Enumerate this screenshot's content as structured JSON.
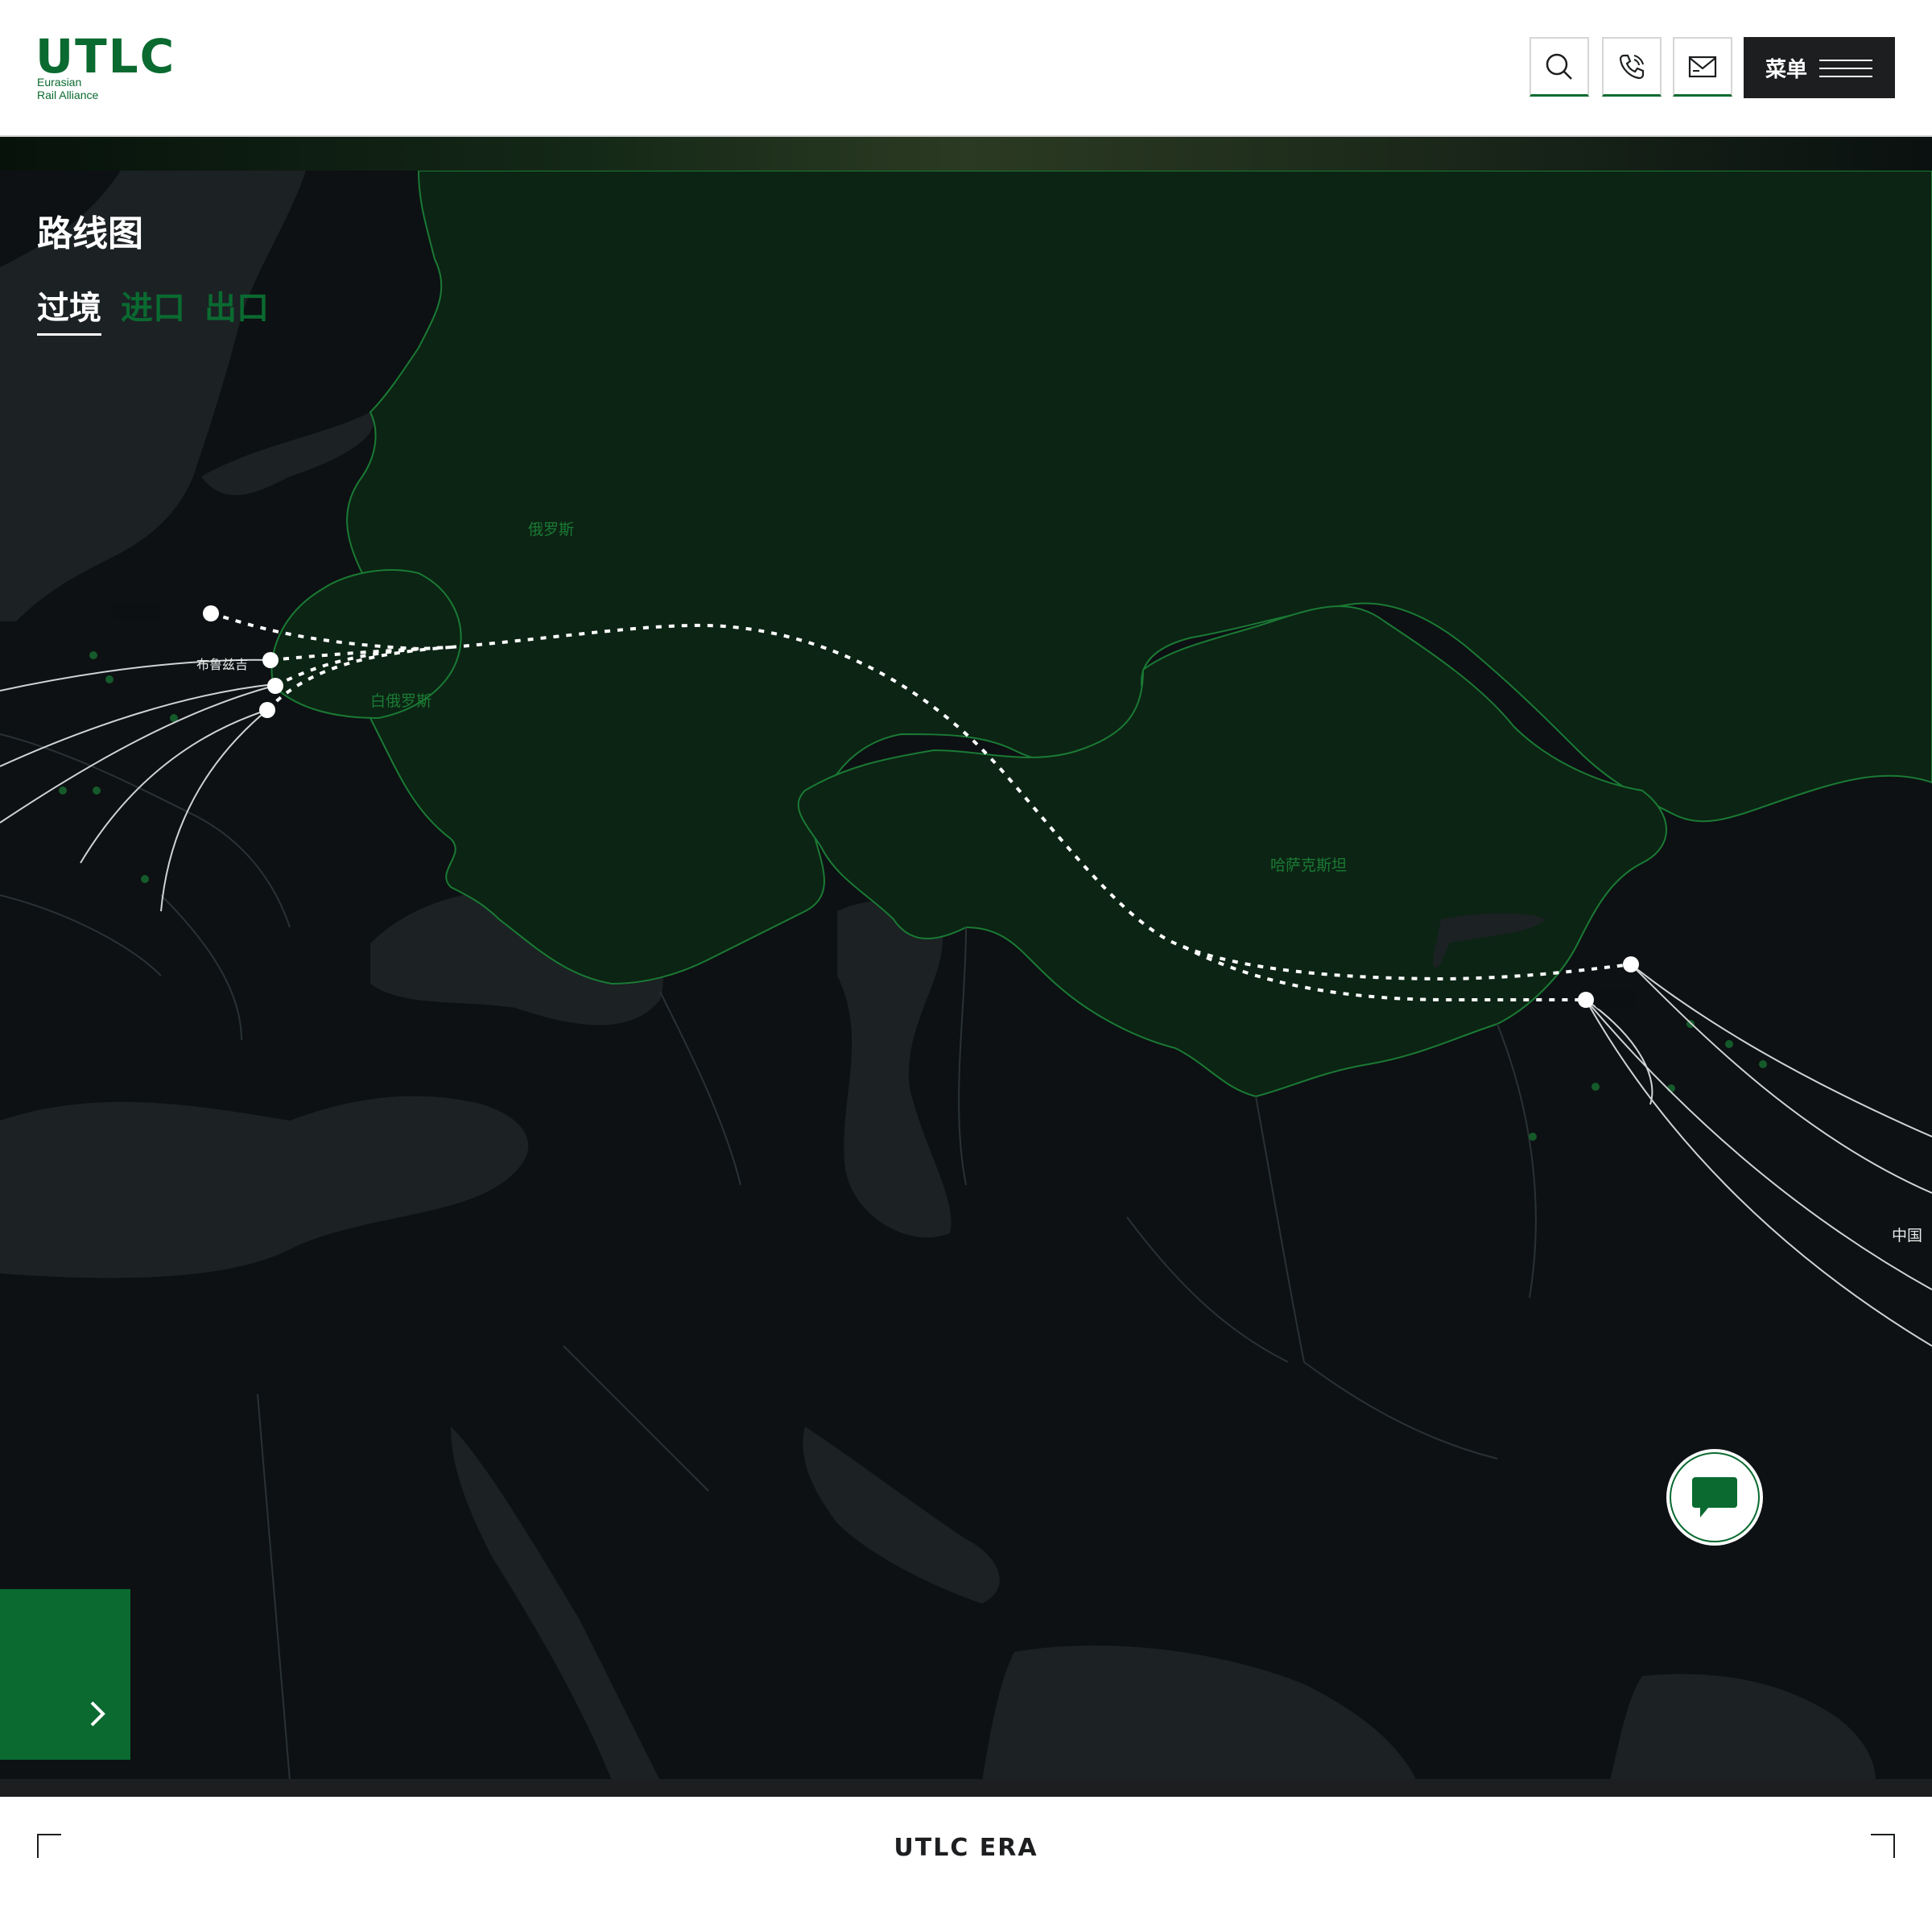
{
  "header": {
    "logo_text": "UTLC",
    "logo_tagline_1": "Eurasian",
    "logo_tagline_2": "Rail Alliance",
    "buttons": {
      "search_icon": "search-icon",
      "phone_icon": "phone-icon",
      "mail_icon": "mail-icon"
    },
    "menu_label": "菜单"
  },
  "map": {
    "title": "路线图",
    "tabs": [
      {
        "label": "过境",
        "active": true
      },
      {
        "label": "进口",
        "active": false
      },
      {
        "label": "出口",
        "active": false
      }
    ],
    "countries": {
      "russia": "俄罗斯",
      "belarus": "白俄罗斯",
      "kazakhstan": "哈萨克斯坦",
      "china": "中国"
    },
    "cities": {
      "brest": "布鲁兹吉"
    },
    "colors": {
      "land_highlight": "#0c2414",
      "border_green": "#1a7a34",
      "background": "#0d1113",
      "route": "#ffffff"
    }
  },
  "footer": {
    "title": "UTLC ERA"
  },
  "accent": "#0a6a30"
}
